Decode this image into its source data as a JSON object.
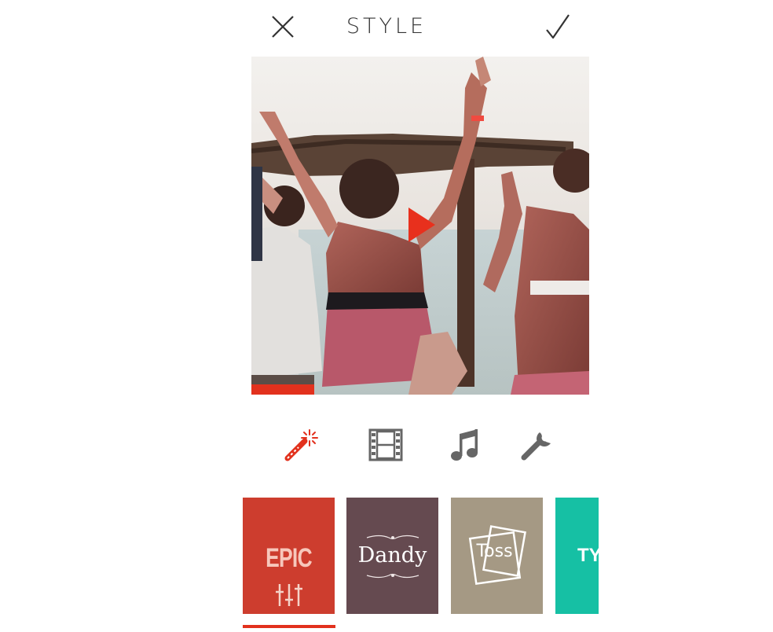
{
  "header": {
    "title": "STYLE"
  },
  "tabs": [
    {
      "icon": "magic-wand-icon",
      "active": true
    },
    {
      "icon": "film-strip-icon",
      "active": false
    },
    {
      "icon": "music-note-icon",
      "active": false
    },
    {
      "icon": "wrench-icon",
      "active": false
    }
  ],
  "styles": {
    "epic": "EPIC",
    "dandy": "Dandy",
    "toss": "Toss",
    "ty": "TY"
  },
  "colors": {
    "accent": "#e2311d",
    "epic": "#cd3d2e",
    "dandy": "#654a50",
    "toss": "#a59984",
    "ty": "#16c0a4"
  }
}
